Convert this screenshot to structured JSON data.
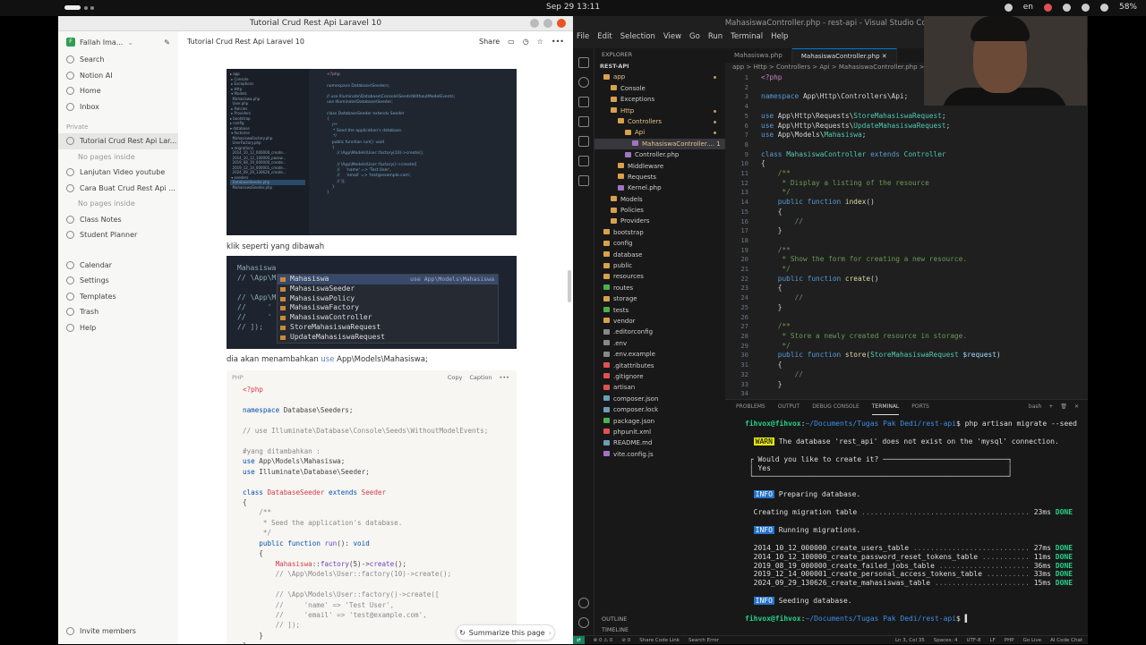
{
  "system": {
    "clock": "Sep 29  13:11",
    "lang": "en",
    "battery": "58%"
  },
  "notion": {
    "window_title": "Tutorial Crud Rest Api Laravel 10",
    "workspace": "Fallah Ima...",
    "sidebar_top": [
      "Search",
      "Notion AI",
      "Home",
      "Inbox"
    ],
    "private_label": "Private",
    "private_items": [
      {
        "label": "Tutorial Crud Rest Api Lar...",
        "active": true
      },
      {
        "label": "No pages inside",
        "empty": true
      },
      {
        "label": "Lanjutan Video youtube"
      },
      {
        "label": "Cara Buat Crud Rest Api ..."
      },
      {
        "label": "No pages inside",
        "empty": true
      },
      {
        "label": "Class Notes"
      },
      {
        "label": "Student Planner"
      }
    ],
    "sidebar_bottom": [
      "Calendar",
      "Settings",
      "Templates",
      "Trash",
      "Help"
    ],
    "invite": "Invite members",
    "page_title": "Tutorial Crud Rest Api Laravel 10",
    "share": "Share",
    "para1": "klik seperti yang dibawah",
    "para2_pre": "dia akan menambahkan ",
    "para2_use": "use",
    "para2_post": " App\\Models\\Mahasiswa;",
    "autocomplete": {
      "typed": "Mahasiswa",
      "hint": "use App\\Models\\Mahasiswa",
      "items": [
        "Mahasiswa",
        "MahasiswaSeeder",
        "MahasiswaPolicy",
        "MahasiswaFactory",
        "MahasiswaController",
        "StoreMahasiswaRequest",
        "UpdateMahasiswaRequest"
      ]
    },
    "codeblock": {
      "lang": "PHP",
      "copy": "Copy",
      "caption": "Caption"
    },
    "summarize": "Summarize this page"
  },
  "vscode": {
    "window_title": "MahasiswaController.php - rest-api - Visual Studio Code",
    "menu": [
      "File",
      "Edit",
      "Selection",
      "View",
      "Go",
      "Run",
      "Terminal",
      "Help"
    ],
    "explorer_label": "EXPLORER",
    "project": "REST-API",
    "tabs": [
      "Mahasiswa.php",
      "MahasiswaController.php"
    ],
    "breadcrumbs": "app > Http > Controllers > Api > MahasiswaController.php > {} App\\Http\\C",
    "panel_tabs": [
      "PROBLEMS",
      "OUTPUT",
      "DEBUG CONSOLE",
      "TERMINAL",
      "PORTS"
    ],
    "shell": "bash",
    "outline": "OUTLINE",
    "timeline": "TIMELINE",
    "status_left": [
      "⊗ 0 ⚠ 0",
      "⊘ 0",
      "Share Code Link",
      "Search Error"
    ],
    "status_right": [
      "Ln 3, Col 35",
      "Spaces: 4",
      "UTF-8",
      "LF",
      "PHP",
      "Go Live",
      "AI Code Chat"
    ]
  }
}
